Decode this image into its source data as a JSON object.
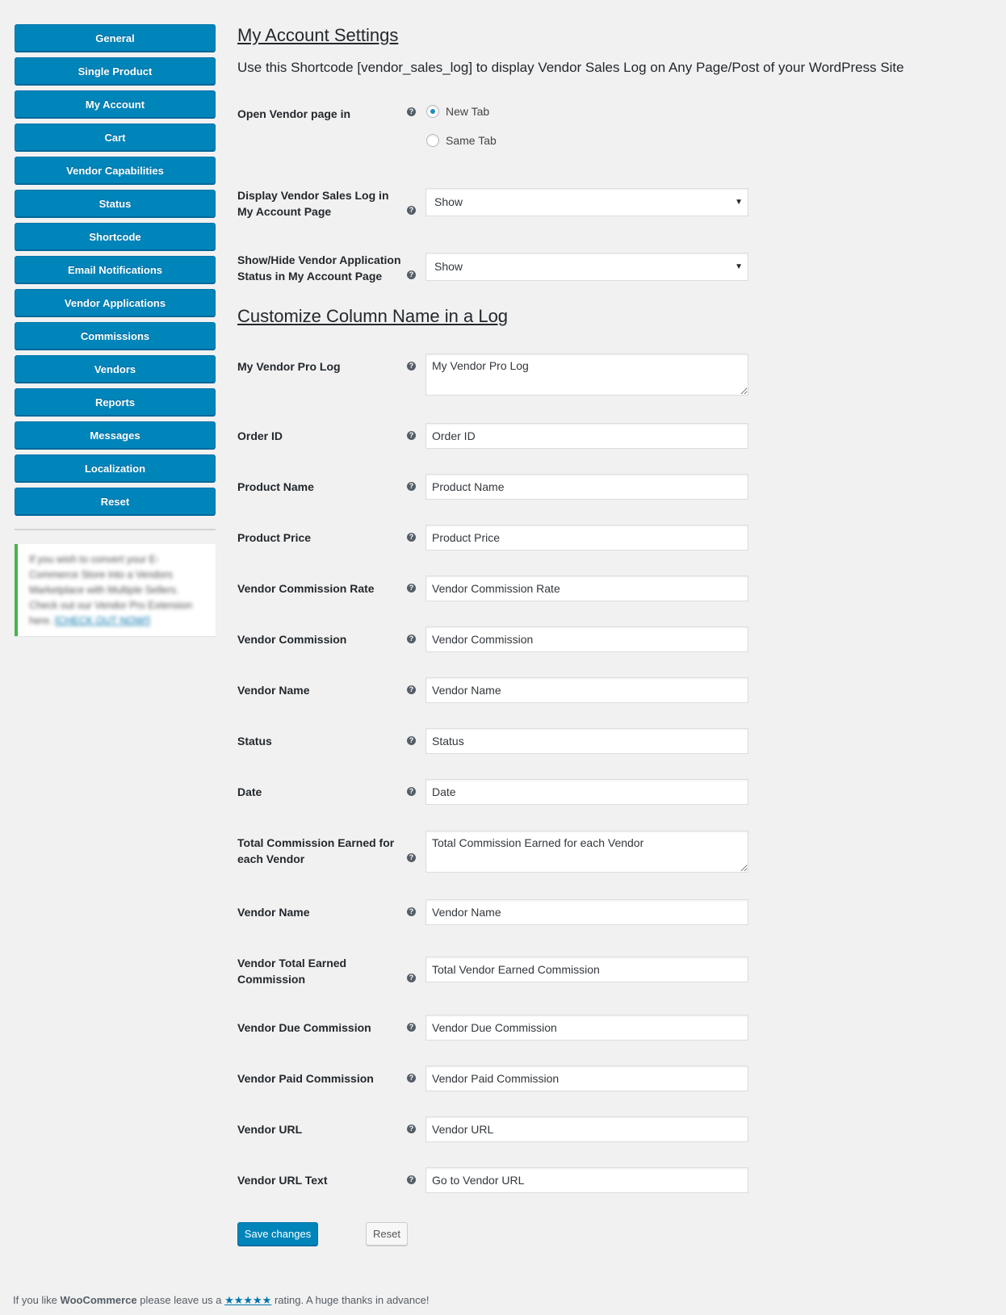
{
  "sidebar": {
    "items": [
      {
        "label": "General"
      },
      {
        "label": "Single Product"
      },
      {
        "label": "My Account"
      },
      {
        "label": "Cart"
      },
      {
        "label": "Vendor Capabilities"
      },
      {
        "label": "Status"
      },
      {
        "label": "Shortcode"
      },
      {
        "label": "Email Notifications"
      },
      {
        "label": "Vendor Applications"
      },
      {
        "label": "Commissions"
      },
      {
        "label": "Vendors"
      },
      {
        "label": "Reports"
      },
      {
        "label": "Messages"
      },
      {
        "label": "Localization"
      },
      {
        "label": "Reset"
      }
    ],
    "notice": {
      "text": "If you wish to convert your E-Commerce Store into a Vendors Marketplace with Multiple Sellers. Check out our Vendor Pro Extension here.",
      "link_label": "[CHECK OUT NOW!]",
      "accent_color": "#46b450"
    }
  },
  "main": {
    "title": "My Account Settings",
    "intro": "Use this Shortcode [vendor_sales_log] to display Vendor Sales Log on Any Page/Post of your WordPress Site",
    "open_vendor": {
      "label": "Open Vendor page in",
      "options": [
        {
          "label": "New Tab",
          "checked": true
        },
        {
          "label": "Same Tab",
          "checked": false
        }
      ]
    },
    "display_log": {
      "label": "Display Vendor Sales Log in My Account Page",
      "value": "Show"
    },
    "show_hide_status": {
      "label": "Show/Hide Vendor Application Status in My Account Page",
      "value": "Show"
    },
    "section_title": "Customize Column Name in a Log",
    "fields": [
      {
        "label": "My Vendor Pro Log",
        "value": "My Vendor Pro Log",
        "type": "textarea"
      },
      {
        "label": "Order ID",
        "value": "Order ID",
        "type": "input"
      },
      {
        "label": "Product Name",
        "value": "Product Name",
        "type": "input"
      },
      {
        "label": "Product Price",
        "value": "Product Price",
        "type": "input"
      },
      {
        "label": "Vendor Commission Rate",
        "value": "Vendor Commission Rate",
        "type": "input"
      },
      {
        "label": "Vendor Commission",
        "value": "Vendor Commission",
        "type": "input"
      },
      {
        "label": "Vendor Name",
        "value": "Vendor Name",
        "type": "input"
      },
      {
        "label": "Status",
        "value": "Status",
        "type": "input"
      },
      {
        "label": "Date",
        "value": "Date",
        "type": "input"
      },
      {
        "label": "Total Commission Earned for each Vendor",
        "value": "Total Commission Earned for each Vendor",
        "type": "textarea"
      },
      {
        "label": "Vendor Name",
        "value": "Vendor Name",
        "type": "input"
      },
      {
        "label": "Vendor Total Earned Commission",
        "value": "Total Vendor Earned Commission",
        "type": "input"
      },
      {
        "label": "Vendor Due Commission",
        "value": "Vendor Due Commission",
        "type": "input"
      },
      {
        "label": "Vendor Paid Commission",
        "value": "Vendor Paid Commission",
        "type": "input"
      },
      {
        "label": "Vendor URL",
        "value": "Vendor URL",
        "type": "input"
      },
      {
        "label": "Vendor URL Text",
        "value": "Go to Vendor URL",
        "type": "input"
      }
    ],
    "help_icon": "question-circle-icon",
    "save_label": "Save changes",
    "reset_label": "Reset"
  },
  "footer": {
    "prefix": "If you like ",
    "brand": "WooCommerce",
    "middle": " please leave us a ",
    "stars": "★★★★★",
    "suffix": " rating. A huge thanks in advance!"
  },
  "colors": {
    "primary": "#0085ba",
    "background": "#f1f1f1"
  }
}
